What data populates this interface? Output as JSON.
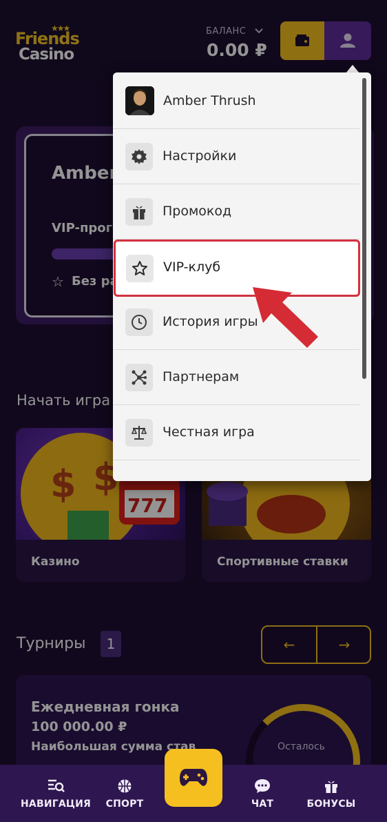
{
  "header": {
    "logo_line1": "Friends",
    "logo_line2": "Casino",
    "balance_label": "БАЛАНС",
    "balance_value": "0.00 ₽"
  },
  "vip_card": {
    "name": "Amber",
    "progress_label": "VIP-прог",
    "rank_label": "Без ра"
  },
  "start_section": {
    "title": "Начать игра",
    "cards": [
      {
        "label": "Казино"
      },
      {
        "label": "Спортивные ставки"
      }
    ]
  },
  "tournaments": {
    "title": "Турниры",
    "count": "1",
    "prev_arrow": "←",
    "next_arrow": "→",
    "card": {
      "name": "Ежедневная гонка",
      "prize": "100 000.00 ₽",
      "description": "Наибольшая сумма став",
      "remaining_label": "Осталось"
    }
  },
  "dropdown": {
    "user_name": "Amber Thrush",
    "items": [
      {
        "label": "Настройки",
        "icon": "gear-icon"
      },
      {
        "label": "Промокод",
        "icon": "gift-icon"
      },
      {
        "label": "VIP-клуб",
        "icon": "star-icon",
        "highlighted": true
      },
      {
        "label": "История игры",
        "icon": "clock-icon"
      },
      {
        "label": "Партнерам",
        "icon": "network-icon"
      },
      {
        "label": "Честная игра",
        "icon": "scales-icon"
      }
    ]
  },
  "bottom_nav": {
    "items": [
      {
        "label": "НАВИГАЦИЯ",
        "icon": "navigation-icon"
      },
      {
        "label": "СПОРТ",
        "icon": "ball-icon"
      },
      {
        "label": "ЧАТ",
        "icon": "chat-icon"
      },
      {
        "label": "БОНУСЫ",
        "icon": "gift-icon"
      }
    ],
    "center_icon": "gamepad-icon"
  },
  "colors": {
    "accent_yellow": "#f5bf1f",
    "accent_purple": "#5f2e9a",
    "background": "#1e0f32",
    "highlight_border": "#d33040"
  }
}
